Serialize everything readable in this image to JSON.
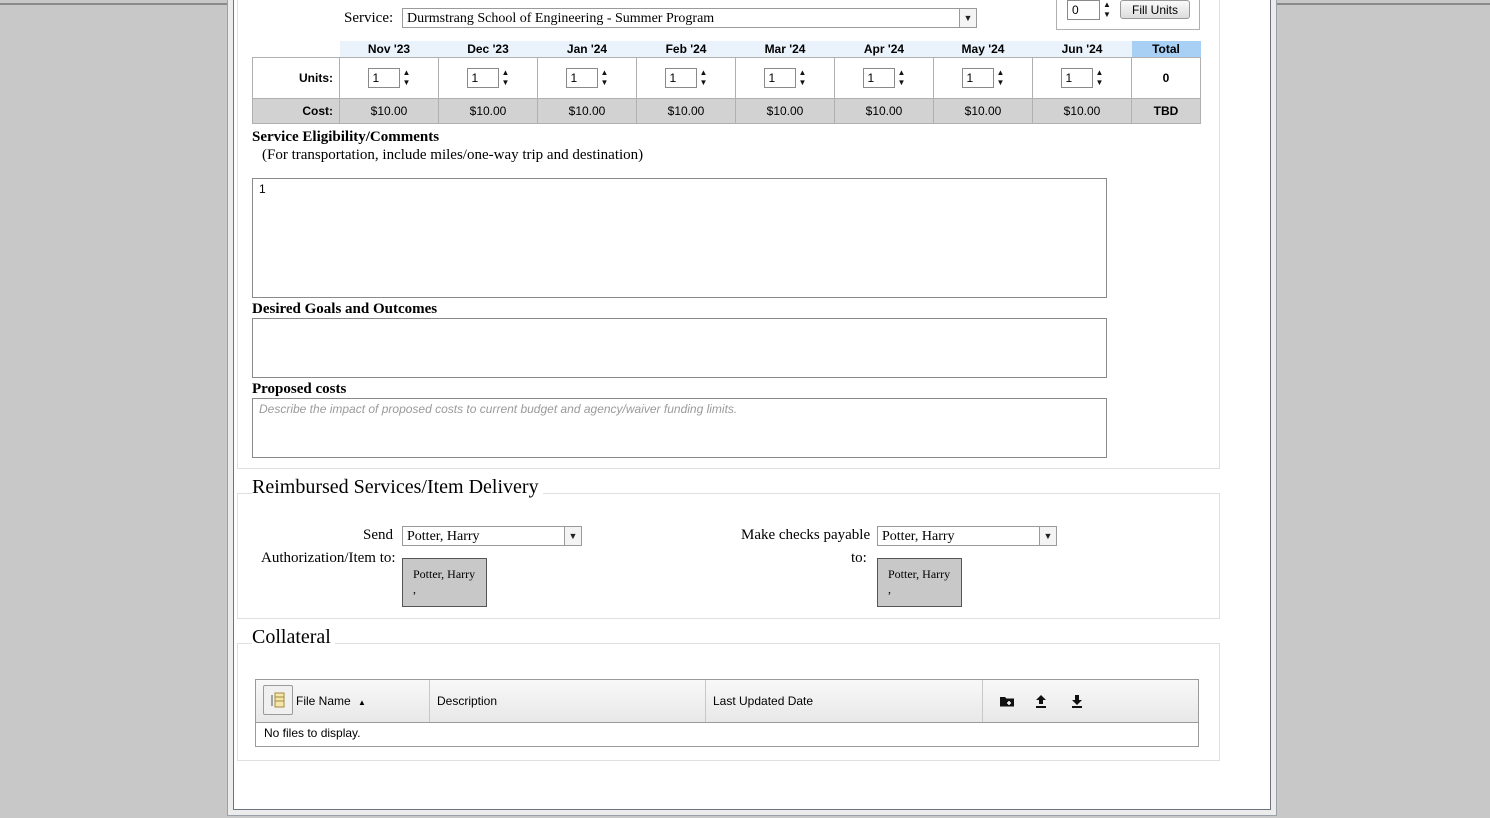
{
  "service": {
    "label": "Service:",
    "value": "Durmstrang School of Engineering - Summer Program",
    "fill_units_value": "0",
    "fill_units_button": "Fill Units"
  },
  "grid": {
    "months": [
      "Nov '23",
      "Dec '23",
      "Jan '24",
      "Feb '24",
      "Mar '24",
      "Apr '24",
      "May '24",
      "Jun '24"
    ],
    "total_label": "Total",
    "units_label": "Units:",
    "units": [
      "1",
      "1",
      "1",
      "1",
      "1",
      "1",
      "1",
      "1"
    ],
    "units_total": "0",
    "cost_label": "Cost:",
    "costs": [
      "$10.00",
      "$10.00",
      "$10.00",
      "$10.00",
      "$10.00",
      "$10.00",
      "$10.00",
      "$10.00"
    ],
    "cost_total": "TBD"
  },
  "eligibility": {
    "title": "Service Eligibility/Comments",
    "subtitle": "(For transportation, include miles/one-way trip and destination)",
    "value": "1"
  },
  "goals": {
    "title": "Desired Goals and Outcomes",
    "value": ""
  },
  "proposed_costs": {
    "title": "Proposed costs",
    "placeholder": "Describe the impact of proposed costs to current budget and agency/waiver funding limits."
  },
  "reimbursed": {
    "title": "Reimbursed Services/Item Delivery",
    "send_label_1": "Send",
    "send_label_2": "Authorization/Item to:",
    "send_value": "Potter, Harry",
    "send_card_line1": "Potter, Harry",
    "send_card_line2": ",",
    "payable_label_1": "Make checks payable",
    "payable_label_2": "to:",
    "payable_value": "Potter, Harry",
    "payable_card_line1": "Potter, Harry",
    "payable_card_line2": ","
  },
  "collateral": {
    "title": "Collateral",
    "columns": {
      "file_name": "File Name",
      "description": "Description",
      "last_updated": "Last Updated Date"
    },
    "empty_message": "No files to display."
  }
}
